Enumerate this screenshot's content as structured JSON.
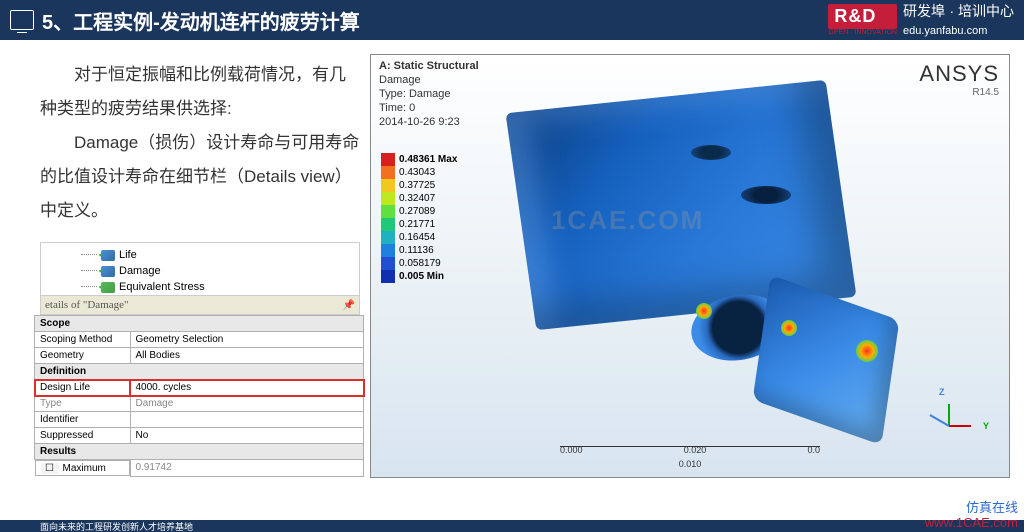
{
  "header": {
    "title": "5、工程实例-发动机连杆的疲劳计算",
    "logo_text": "研发埠",
    "logo_suffix": "· 培训中心",
    "logo_url": "edu.yanfabu.com",
    "logo_rd": "R&D",
    "logo_sub": "OPEN · INNOVATION"
  },
  "paragraph": {
    "line1": "对于恒定振幅和比例载荷情况，有几种类型的疲劳结果供选择:",
    "line2": "Damage（损伤）设计寿命与可用寿命的比值设计寿命在细节栏（Details view）中定义。"
  },
  "tree": {
    "items": [
      {
        "label": "Life"
      },
      {
        "label": "Damage"
      },
      {
        "label": "Equivalent Stress"
      }
    ]
  },
  "details": {
    "title": "etails of \"Damage\"",
    "sections": {
      "scope": {
        "header": "Scope",
        "rows": [
          {
            "k": "Scoping Method",
            "v": "Geometry Selection"
          },
          {
            "k": "Geometry",
            "v": "All Bodies"
          }
        ]
      },
      "definition": {
        "header": "Definition",
        "rows": [
          {
            "k": "Design Life",
            "v": "4000. cycles",
            "hl": true
          },
          {
            "k": "Type",
            "v": "Damage"
          },
          {
            "k": "Identifier",
            "v": ""
          },
          {
            "k": "Suppressed",
            "v": "No"
          }
        ]
      },
      "results": {
        "header": "Results",
        "rows": [
          {
            "k": "Maximum",
            "v": "0.91742",
            "check": true
          }
        ]
      }
    }
  },
  "viewer": {
    "solution_title": "A: Static Structural",
    "result": "Damage",
    "type": "Type: Damage",
    "time": "Time: 0",
    "timestamp": "2014-10-26 9:23",
    "brand": "ANSYS",
    "version": "R14.5",
    "watermark": "1CAE.COM",
    "legend": [
      {
        "label": "0.48361 Max",
        "color": "#d62020"
      },
      {
        "label": "0.43043",
        "color": "#f07020"
      },
      {
        "label": "0.37725",
        "color": "#f0c820"
      },
      {
        "label": "0.32407",
        "color": "#c0e820"
      },
      {
        "label": "0.27089",
        "color": "#60e040"
      },
      {
        "label": "0.21771",
        "color": "#20c878"
      },
      {
        "label": "0.16454",
        "color": "#20b0c0"
      },
      {
        "label": "0.11136",
        "color": "#2080e0"
      },
      {
        "label": "0.058179",
        "color": "#2050d0"
      },
      {
        "label": "0.005 Min",
        "color": "#1030b0"
      }
    ],
    "scale": {
      "a": "0.000",
      "b": "0.020",
      "c": "0.010",
      "suffix": "0.0"
    }
  },
  "footer": {
    "text": "面向未来的工程研发创新人才培养基地",
    "watermark1": "仿真在线",
    "watermark2": "www.1CAE.com"
  }
}
